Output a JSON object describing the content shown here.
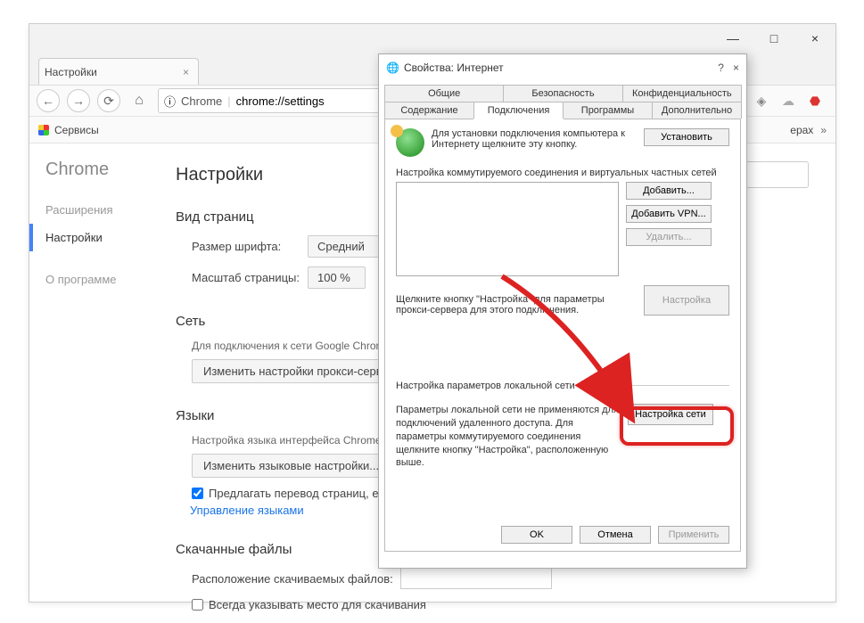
{
  "browser": {
    "tab_title": "Настройки",
    "omnibox_chip": "Chrome",
    "omnibox_url": "chrome://settings",
    "bookmarks_label": "Сервисы",
    "bookmarks_right": "ерах"
  },
  "sidebar": {
    "brand": "Chrome",
    "items": [
      "Расширения",
      "Настройки",
      "О программе"
    ]
  },
  "page": {
    "title": "Настройки"
  },
  "view": {
    "heading": "Вид страниц",
    "font_label": "Размер шрифта:",
    "font_value": "Средний",
    "zoom_label": "Масштаб страницы:",
    "zoom_value": "100 %"
  },
  "network": {
    "heading": "Сеть",
    "desc": "Для подключения к сети Google Chrom",
    "btn": "Изменить настройки прокси-сервера"
  },
  "lang": {
    "heading": "Языки",
    "desc": "Настройка языка интерфейса Chrome и",
    "btn": "Изменить языковые настройки...",
    "offer_translate": "Предлагать перевод страниц, если",
    "manage": "Управление языками"
  },
  "downloads": {
    "heading": "Скачанные файлы",
    "path_label": "Расположение скачиваемых файлов:",
    "always_ask": "Всегда указывать место для скачивания"
  },
  "dialog": {
    "title": "Свойства: Интернет",
    "tabs_row1": [
      "Общие",
      "Безопасность",
      "Конфиденциальность"
    ],
    "tabs_row2": [
      "Содержание",
      "Подключения",
      "Программы",
      "Дополнительно"
    ],
    "setup_text": "Для установки подключения компьютера к Интернету щелкните эту кнопку.",
    "setup_btn": "Установить",
    "conn_heading": "Настройка коммутируемого соединения и виртуальных частных сетей",
    "add_btn": "Добавить...",
    "add_vpn_btn": "Добавить VPN...",
    "delete_btn": "Удалить...",
    "settings_btn": "Настройка",
    "proxy_note": "Щелкните кнопку \"Настройка\" для параметры прокси-сервера для этого подключения.",
    "lan_heading": "Настройка параметров локальной сети",
    "lan_text": "Параметры локальной сети не применяются для подключений удаленного доступа. Для параметры коммутируемого соединения щелкните кнопку \"Настройка\", расположенную выше.",
    "lan_btn": "Настройка сети",
    "ok": "OK",
    "cancel": "Отмена",
    "apply": "Применить"
  }
}
